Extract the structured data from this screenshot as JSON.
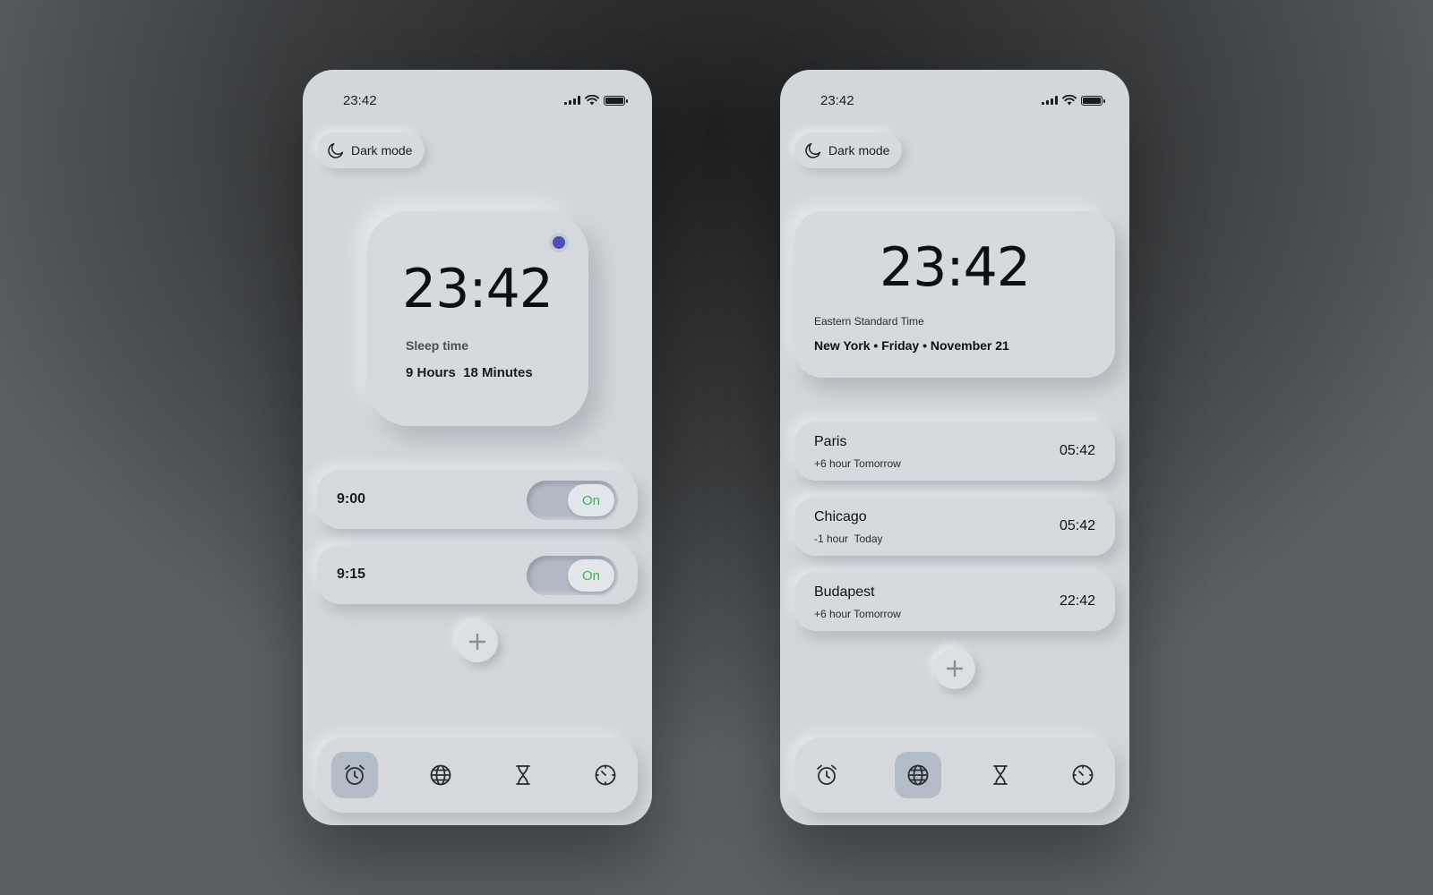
{
  "left_phone": {
    "status_time": "23:42",
    "dark_mode_label": "Dark mode",
    "clock_time": "23:42",
    "sleep_label": "Sleep time",
    "sleep_value": "9 Hours  18 Minutes",
    "alarms": [
      {
        "time": "9:00",
        "toggle_label": "On"
      },
      {
        "time": "9:15",
        "toggle_label": "On"
      }
    ],
    "active_tab": "alarm"
  },
  "right_phone": {
    "status_time": "23:42",
    "dark_mode_label": "Dark mode",
    "clock_time": "23:42",
    "timezone": "Eastern Standard Time",
    "location_line": "New York • Friday • November 21",
    "cities": [
      {
        "name": "Paris",
        "offset": "+6 hour Tomorrow",
        "time": "05:42"
      },
      {
        "name": "Chicago",
        "offset": "-1 hour  Today",
        "time": "05:42"
      },
      {
        "name": "Budapest",
        "offset": "+6 hour Tomorrow",
        "time": "22:42"
      }
    ],
    "active_tab": "world-clock"
  },
  "nav_tabs": [
    {
      "icon": "alarm-clock-icon"
    },
    {
      "icon": "globe-icon"
    },
    {
      "icon": "hourglass-icon"
    },
    {
      "icon": "stopwatch-icon"
    }
  ],
  "colors": {
    "accent_dot": "#4d4dbb",
    "toggle_on_text": "#3cb45a",
    "active_tab_bg": "#b4bcc8",
    "panel_bg": "#d3d6da"
  }
}
